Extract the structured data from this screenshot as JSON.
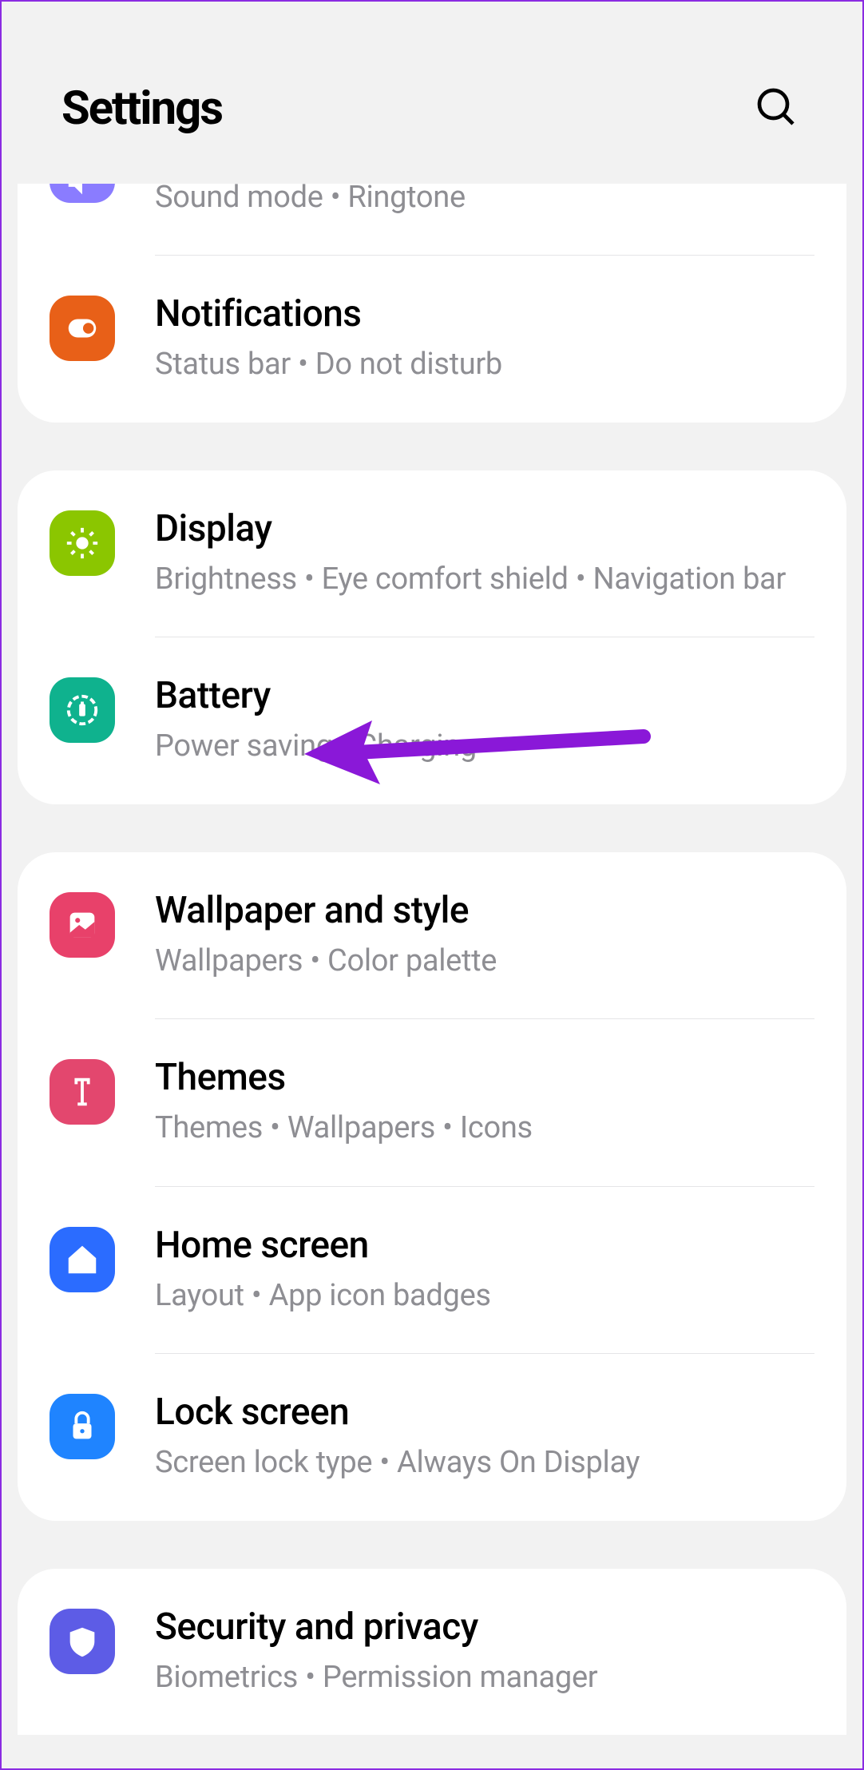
{
  "header": {
    "title": "Settings"
  },
  "groups": [
    {
      "items": [
        {
          "key": "sounds",
          "title": "",
          "subtitle": "Sound mode  •  Ringtone",
          "partial": true
        },
        {
          "key": "notifications",
          "title": "Notifications",
          "subtitle": "Status bar  •  Do not disturb"
        }
      ]
    },
    {
      "items": [
        {
          "key": "display",
          "title": "Display",
          "subtitle": "Brightness  •  Eye comfort shield  •  Navigation bar"
        },
        {
          "key": "battery",
          "title": "Battery",
          "subtitle": "Power saving  •  Charging"
        }
      ]
    },
    {
      "items": [
        {
          "key": "wallpaper",
          "title": "Wallpaper and style",
          "subtitle": "Wallpapers  •  Color palette"
        },
        {
          "key": "themes",
          "title": "Themes",
          "subtitle": "Themes  •  Wallpapers  •  Icons"
        },
        {
          "key": "home",
          "title": "Home screen",
          "subtitle": "Layout  •  App icon badges"
        },
        {
          "key": "lock",
          "title": "Lock screen",
          "subtitle": "Screen lock type  •  Always On Display"
        }
      ]
    },
    {
      "items": [
        {
          "key": "security",
          "title": "Security and privacy",
          "subtitle": "Biometrics  •  Permission manager"
        }
      ]
    }
  ],
  "annotation": {
    "target": "battery"
  }
}
